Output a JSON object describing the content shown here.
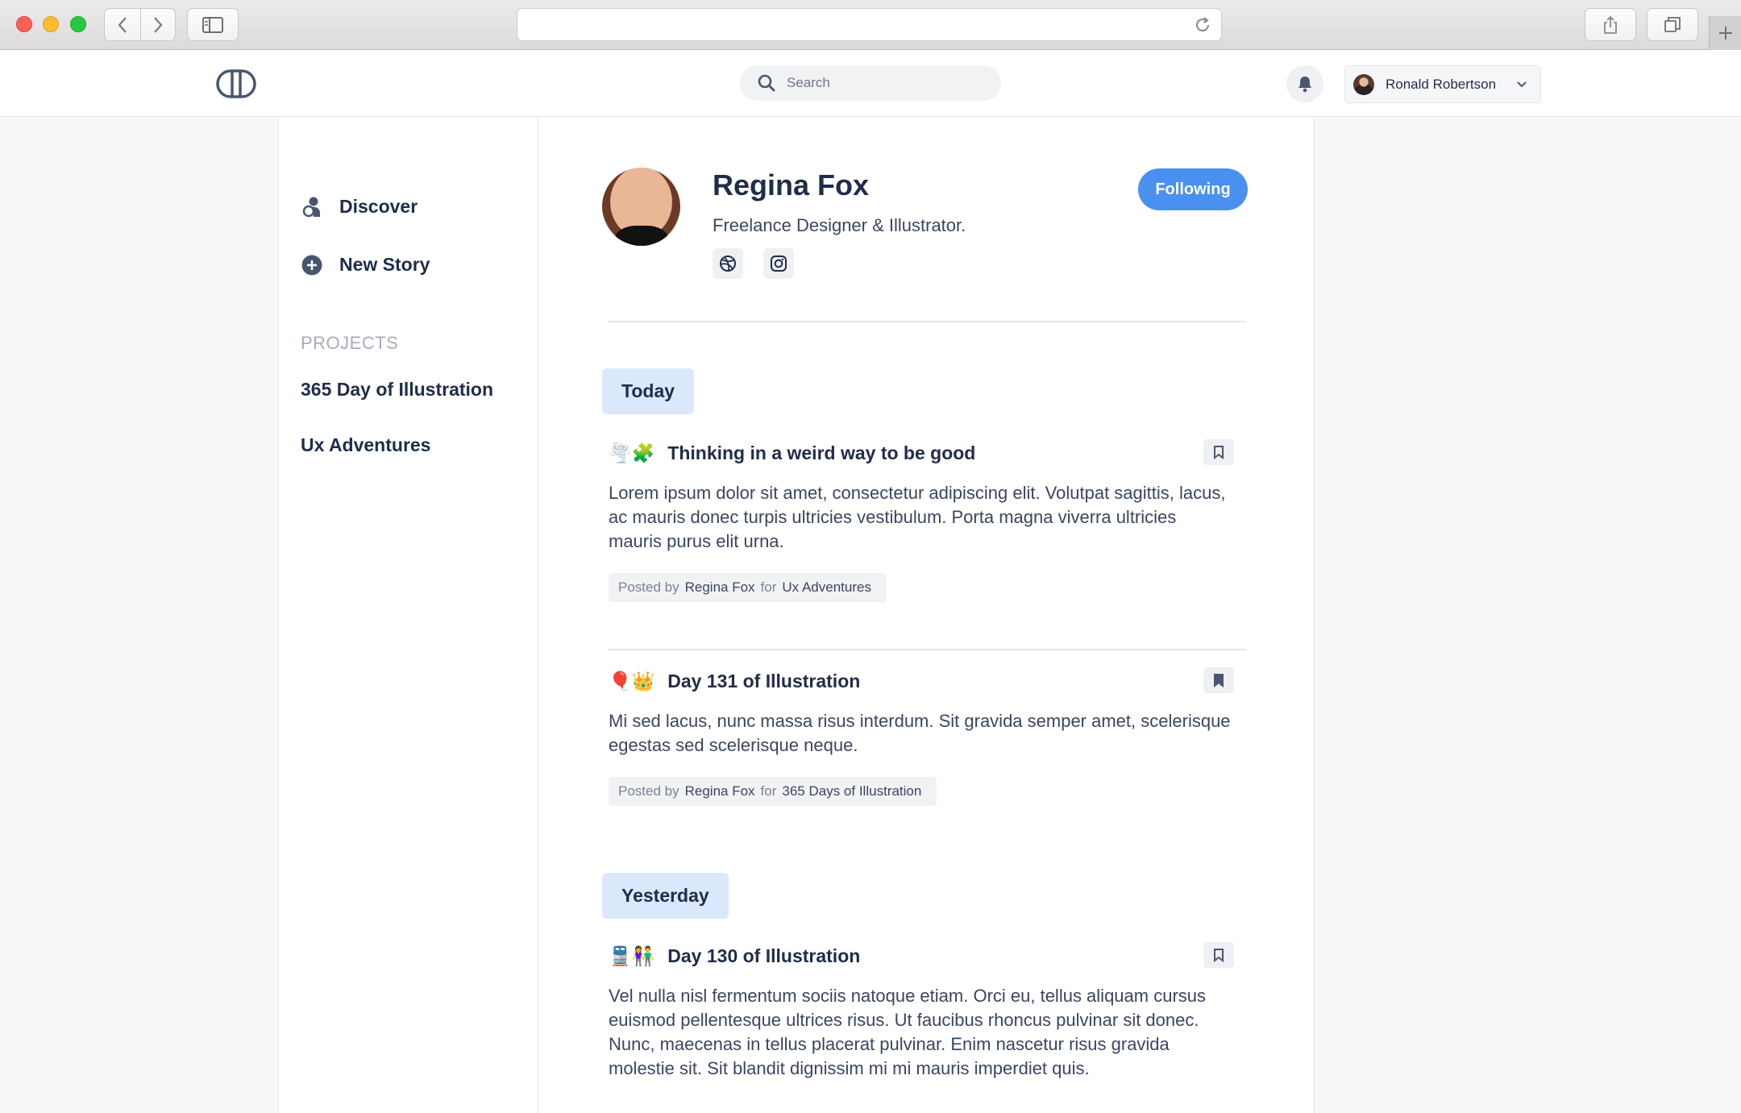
{
  "header": {
    "search_placeholder": "Search",
    "user_name": "Ronald Robertson"
  },
  "sidebar": {
    "nav": [
      {
        "label": "Discover",
        "icon": "user-discover-icon"
      },
      {
        "label": "New Story",
        "icon": "plus-circle-icon"
      }
    ],
    "projects_heading": "PROJECTS",
    "projects": [
      "365 Day of Illustration",
      "Ux Adventures"
    ]
  },
  "profile": {
    "name": "Regina Fox",
    "bio": "Freelance Designer & Illustrator.",
    "follow_label": "Following",
    "social": [
      "dribbble-icon",
      "instagram-icon"
    ]
  },
  "feed": {
    "today_label": "Today",
    "yesterday_label": "Yesterday",
    "stories": [
      {
        "emoji": "🌪️🧩",
        "title": "Thinking in a weird way to be good",
        "body": "Lorem ipsum dolor sit amet, consectetur adipiscing elit. Volutpat sagittis, lacus, ac mauris donec turpis ultricies vestibulum. Porta magna viverra ultricies mauris purus elit urna.",
        "posted_by_label": "Posted by",
        "author": "Regina Fox",
        "for_label": "for",
        "project": "Ux Adventures",
        "bookmarked": false
      },
      {
        "emoji": "🎈👑",
        "title": "Day 131 of Illustration",
        "body": "Mi sed lacus, nunc massa risus interdum. Sit gravida semper amet, scelerisque egestas sed scelerisque neque.",
        "posted_by_label": "Posted by",
        "author": "Regina Fox",
        "for_label": "for",
        "project": "365 Days of Illustration",
        "bookmarked": true
      },
      {
        "emoji": "🚆👫",
        "title": "Day 130 of Illustration",
        "body": "Vel nulla nisl fermentum sociis natoque etiam. Orci eu, tellus aliquam cursus euismod pellentesque ultrices risus. Ut faucibus rhoncus pulvinar sit donec. Nunc, maecenas in tellus placerat pulvinar. Enim nascetur risus gravida molestie sit. Sit blandit dignissim mi mi mauris imperdiet quis.",
        "bookmarked": false
      }
    ]
  },
  "colors": {
    "accent": "#4a90f0",
    "day_tag_bg": "#dbe8fb",
    "text": "#1f2d4a"
  }
}
